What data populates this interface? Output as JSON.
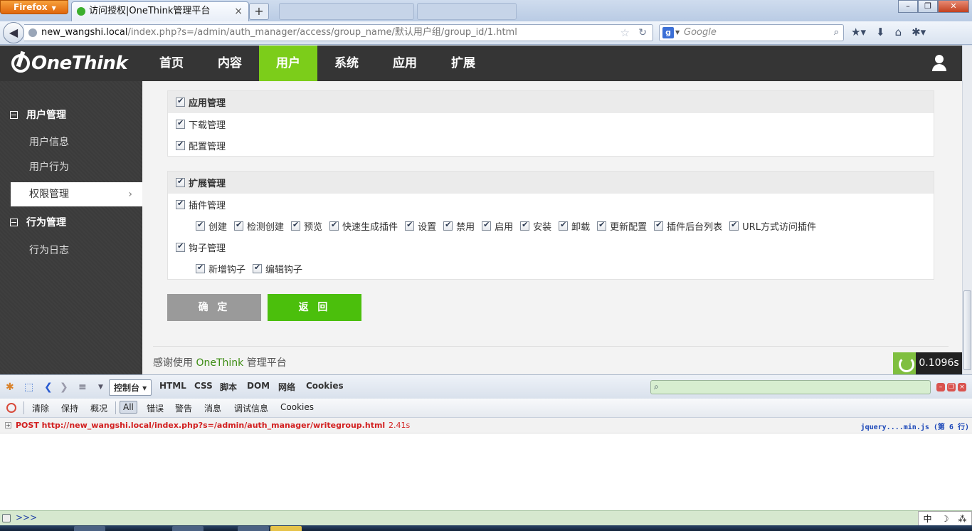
{
  "browser": {
    "menu_button": "Firefox",
    "tab_title": "访问授权|OneThink管理平台",
    "tab_close": "×",
    "new_tab": "+",
    "url_host": "new_wangshi.local",
    "url_path": "/index.php?s=/admin/auth_manager/access/group_name/默认用户组/group_id/1.html",
    "search_placeholder": "Google",
    "window_buttons": [
      "–",
      "❐",
      "✕"
    ]
  },
  "app": {
    "logo": "OneThink",
    "menu": [
      "首页",
      "内容",
      "用户",
      "系统",
      "应用",
      "扩展"
    ],
    "active_menu": "用户"
  },
  "sidebar": {
    "groups": [
      {
        "title": "用户管理",
        "items": [
          "用户信息",
          "用户行为",
          "权限管理"
        ]
      },
      {
        "title": "行为管理",
        "items": [
          "行为日志"
        ]
      }
    ],
    "active_item": "权限管理"
  },
  "panels": [
    {
      "title": "应用管理",
      "rows": [
        {
          "label": "下载管理",
          "children": []
        },
        {
          "label": "配置管理",
          "children": []
        }
      ]
    },
    {
      "title": "扩展管理",
      "rows": [
        {
          "label": "插件管理",
          "children": [
            "创建",
            "检测创建",
            "预览",
            "快速生成插件",
            "设置",
            "禁用",
            "启用",
            "安装",
            "卸载",
            "更新配置",
            "插件后台列表",
            "URL方式访问插件"
          ]
        },
        {
          "label": "钩子管理",
          "children": [
            "新增钩子",
            "编辑钩子"
          ]
        }
      ]
    }
  ],
  "buttons": {
    "confirm": "确 定",
    "back": "返 回"
  },
  "footer": {
    "prefix": "感谢使用 ",
    "brand": "OneThink",
    "suffix": " 管理平台",
    "perf_time": "0.1096s"
  },
  "firebug": {
    "tabs": [
      "控制台 ▾",
      "HTML",
      "CSS",
      "脚本",
      "DOM",
      "网络",
      "Cookies"
    ],
    "filters": [
      "清除",
      "保持",
      "概况",
      "All",
      "错误",
      "警告",
      "消息",
      "调试信息",
      "Cookies"
    ],
    "active_filter": "All",
    "log": {
      "request": "POST http://new_wangshi.local/index.php?s=/admin/auth_manager/writegroup.html",
      "time": "2.41s",
      "source": "jquery....min.js (第 6 行)"
    },
    "prompt": ">>>",
    "ime": [
      "中",
      "☽",
      "⁂"
    ]
  }
}
